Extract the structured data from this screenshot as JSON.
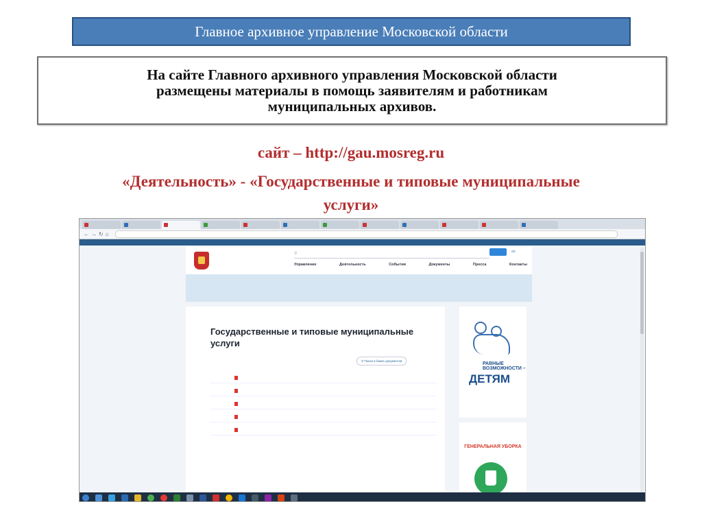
{
  "slide": {
    "header": "Главное архивное управление Московской области",
    "info_lines": [
      "На сайте Главного архивного управления Московской области",
      "размещены материалы в помощь заявителям и работникам",
      "муниципальных архивов."
    ],
    "site_line": "сайт – http://gau.mosreg.ru",
    "activity_line": "«Деятельность» -  «Государственные и типовые муниципальные",
    "activity_line2": "услуги»"
  },
  "screenshot": {
    "page_title": "Государственные и типовые муниципальные услуги",
    "menu": [
      "Управление",
      "Деятельность",
      "События",
      "Документы",
      "Пресса",
      "Контакты"
    ],
    "search_docs_label": "Поиск в банке документов",
    "banner_text_1": "РАВНЫЕ ВОЗМОЖНОСТИ –",
    "banner_text_2": "ДЕТЯМ",
    "banner2_text": "ГЕНЕРАЛЬНАЯ УБОРКА"
  },
  "colors": {
    "banner_bg": "#4a7eb8",
    "red_text": "#b32e2e"
  }
}
